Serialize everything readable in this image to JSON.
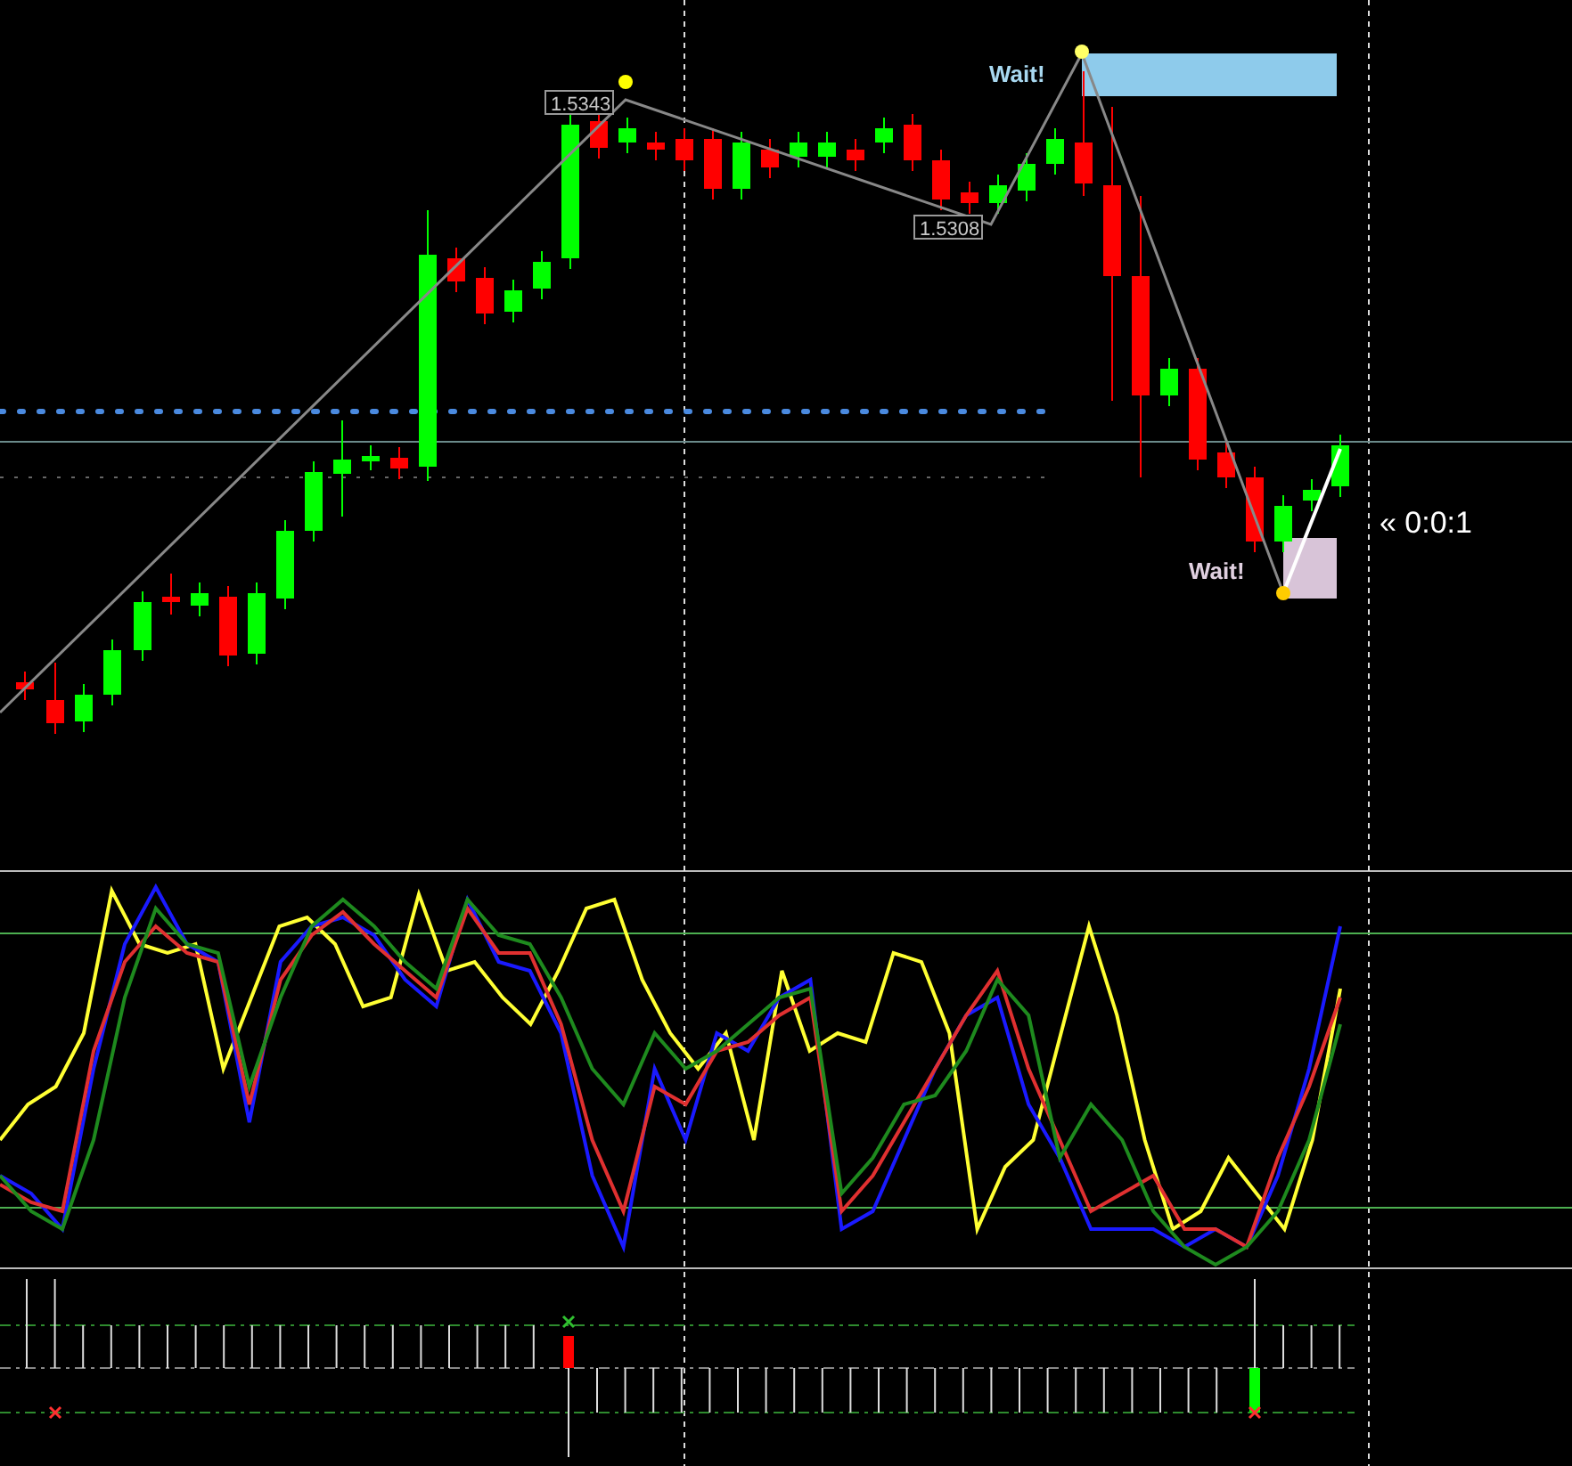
{
  "price_labels": [
    {
      "text": "1.5343"
    },
    {
      "text": "1.5308"
    }
  ],
  "signals": [
    {
      "text": "Wait!",
      "kind": "sell"
    },
    {
      "text": "Wait!",
      "kind": "buy"
    }
  ],
  "timer": "« 0:0:1"
}
